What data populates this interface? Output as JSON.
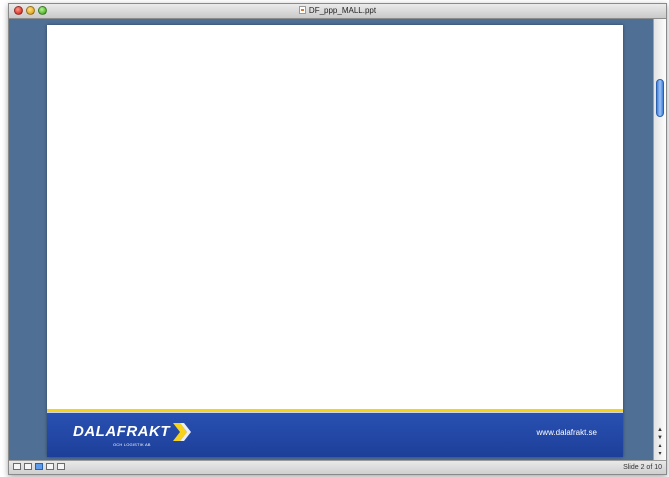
{
  "window": {
    "title": "DF_ppp_MALL.ppt"
  },
  "slide": {
    "logo_text": "DALAFRAKT",
    "logo_subtitle": "OCH LOGISTIK AB",
    "website": "www.dalafrakt.se",
    "colors": {
      "footer_blue": "#2a52b3",
      "footer_stripe": "#f6d21b"
    }
  },
  "status": {
    "slide_indicator": "Slide 2 of 10"
  },
  "view_buttons": [
    {
      "icon": "normal-view-icon",
      "active": false
    },
    {
      "icon": "outline-view-icon",
      "active": false
    },
    {
      "icon": "slide-view-icon",
      "active": true
    },
    {
      "icon": "slide-sorter-icon",
      "active": false
    },
    {
      "icon": "slideshow-icon",
      "active": false
    }
  ],
  "scroll": {
    "icons": [
      "previous-slide-icon",
      "next-slide-icon"
    ]
  }
}
